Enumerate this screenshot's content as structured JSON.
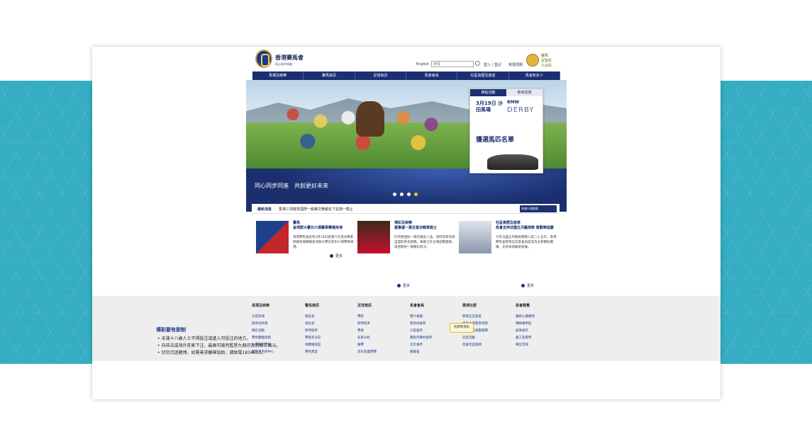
{
  "header": {
    "brand": "香港賽馬會",
    "brand_sub": "同心同步同進",
    "lang": "English",
    "search_placeholder": "搜尋",
    "login": "登入 / 登記",
    "faq": "常見問題",
    "lotto": [
      "賽馬",
      "足智彩",
      "六合彩"
    ]
  },
  "nav": [
    "馬場及娛樂",
    "賽馬資訊",
    "足球資訊",
    "馬會會員",
    "社區資歷及慈善",
    "馬會知多少"
  ],
  "hero": {
    "slogan": "同心同步同進　共創更好未來",
    "promo_tabs": [
      "焦點活動",
      "節目巡禮"
    ],
    "promo_date": "3月19日 沙田馬場",
    "promo_bmw": "BMW",
    "promo_derby": "DERBY",
    "promo_title": "獲選馬匹名單"
  },
  "news": {
    "label": "最新消息",
    "text": "香港三項春季國際一級賽交費報名下星期一截止",
    "badge": "馬會行政總裁"
  },
  "cards": [
    {
      "title": "賽馬\n金翎群大賽日六場賽事轉播來港",
      "body": "香港賽馬會宣布3月18日星期六於澳洲弗萊明頓馬場轉播金翎群大賽日其中六場賽事來港。",
      "more": "更多"
    },
    {
      "title": "博彩及娛樂\n曼聯遇一萬近當決戰車路士",
      "body": "仍然要面對一場足總盃八強，現時皇家馬德里面對更多挑戰，車路士於主場迎戰曼聯，球迷期待一場精彩對決。",
      "more": "更多"
    },
    {
      "title": "社區資歷及慈善\n馬會支持法國五月藝術節 賀歡樂話慶",
      "body": "今年法國五月藝術節踏入第二十五年，香港賽馬會慈善信託基金再度成為主要贊助機構，支持本地藝術發展。",
      "more": "更多"
    }
  ],
  "footer": [
    {
      "head": "馬場及娛樂",
      "items": [
        "沙田馬場",
        "跑馬地馬場",
        "精彩活動",
        "賽馬體驗指南",
        "公眾騎術學校",
        "雙魚河馬術中心"
      ]
    },
    {
      "head": "賽馬資訊",
      "items": [
        "報名表",
        "排位表",
        "即時賠率",
        "賽果及派彩",
        "視聽播放區",
        "賽馬教室"
      ]
    },
    {
      "head": "足球資訊",
      "items": [
        "賽程",
        "即時賠率",
        "賽果",
        "名家分析",
        "聯賽",
        "足彩及國際賽"
      ]
    },
    {
      "head": "馬會會員",
      "items": [
        "簡介會籍",
        "跑馬地會所",
        "沙田會所",
        "雙魚河鄉村會所",
        "北京會所",
        "競駿會"
      ]
    },
    {
      "head": "惠澤社群",
      "items": [
        "慈善信託基金",
        "馬會主導慈善項目",
        "十大社區貢獻範疇",
        "社區活動",
        "馬會社區服務"
      ]
    },
    {
      "head": "馬會概覽",
      "items": [
        "廉政公署顧問",
        "傳媒專用區",
        "盛事速年",
        "義工及獎學",
        "職位空缺"
      ]
    }
  ],
  "responsible": {
    "title": "博彩要有節制",
    "lines": [
      "未滿十八歲人士不得投注或進入可投注的地方。",
      "向非法或海外莊家下注，最高可被判監禁九個月及罰款三萬元。",
      "切勿沉迷賭博，如需尋求輔導協助，請致電1834633。"
    ],
    "badge": "有節制博彩"
  }
}
